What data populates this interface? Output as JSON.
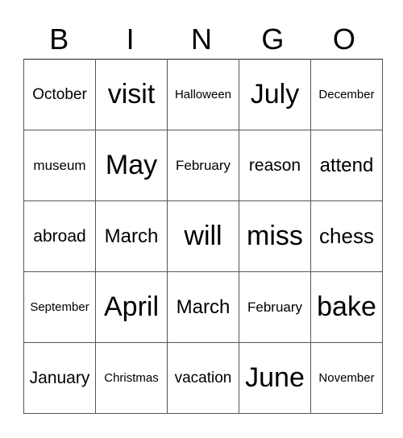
{
  "header": [
    "B",
    "I",
    "N",
    "G",
    "O"
  ],
  "grid": [
    [
      "October",
      "visit",
      "Halloween",
      "July",
      "December"
    ],
    [
      "museum",
      "May",
      "February",
      "reason",
      "attend"
    ],
    [
      "abroad",
      "March",
      "will",
      "miss",
      "chess"
    ],
    [
      "September",
      "April",
      "March",
      "February",
      "bake"
    ],
    [
      "January",
      "Christmas",
      "vacation",
      "June",
      "November"
    ]
  ]
}
